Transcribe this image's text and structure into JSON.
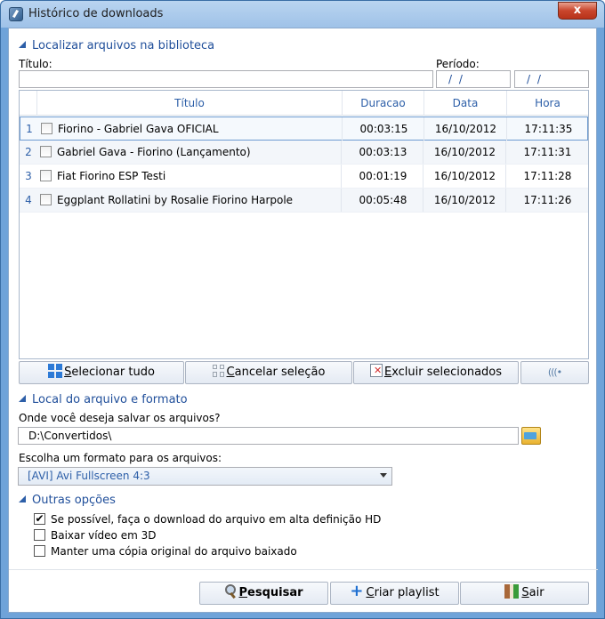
{
  "window": {
    "title": "Histórico de downloads",
    "close_label": "x"
  },
  "library": {
    "section_title": "Localizar arquivos na biblioteca",
    "title_label": "Título:",
    "title_value": "",
    "period_label": "Período:",
    "period_from": "/ /",
    "period_to": "/ /"
  },
  "table": {
    "headers": {
      "title": "Título",
      "duration": "Duracao",
      "date": "Data",
      "time": "Hora"
    },
    "rows": [
      {
        "n": "1",
        "title": "Fiorino - Gabriel Gava OFICIAL",
        "duration": "00:03:15",
        "date": "16/10/2012",
        "time": "17:11:35"
      },
      {
        "n": "2",
        "title": "Gabriel Gava - Fiorino (Lançamento)",
        "duration": "00:03:13",
        "date": "16/10/2012",
        "time": "17:11:31"
      },
      {
        "n": "3",
        "title": "Fiat Fiorino ESP Testi",
        "duration": "00:01:19",
        "date": "16/10/2012",
        "time": "17:11:28"
      },
      {
        "n": "4",
        "title": "Eggplant Rollatini by Rosalie Fiorino Harpole",
        "duration": "00:05:48",
        "date": "16/10/2012",
        "time": "17:11:26"
      }
    ]
  },
  "actions": {
    "select_all_u": "S",
    "select_all_rest": "elecionar tudo",
    "cancel_u": "C",
    "cancel_rest": "ancelar seleção",
    "delete_u": "E",
    "delete_rest": "xcluir selecionados",
    "sound": "(((•"
  },
  "location": {
    "section_title": "Local do arquivo e formato",
    "save_label": "Onde você deseja salvar os arquivos?",
    "save_path": "D:\\Convertidos\\",
    "format_label": "Escolha um formato para os arquivos:",
    "format_value": "[AVI] Avi Fullscreen 4:3"
  },
  "other": {
    "section_title": "Outras opções",
    "options": [
      {
        "label": "Se possível, faça o download do arquivo em alta definição HD",
        "checked": "✔"
      },
      {
        "label": "Baixar vídeo em 3D",
        "checked": ""
      },
      {
        "label": "Manter uma cópia original do arquivo baixado",
        "checked": ""
      }
    ]
  },
  "footer": {
    "search_u": "P",
    "search_rest": "esquisar",
    "playlist_u": "C",
    "playlist_rest": "riar playlist",
    "exit_u": "S",
    "exit_rest": "air"
  }
}
